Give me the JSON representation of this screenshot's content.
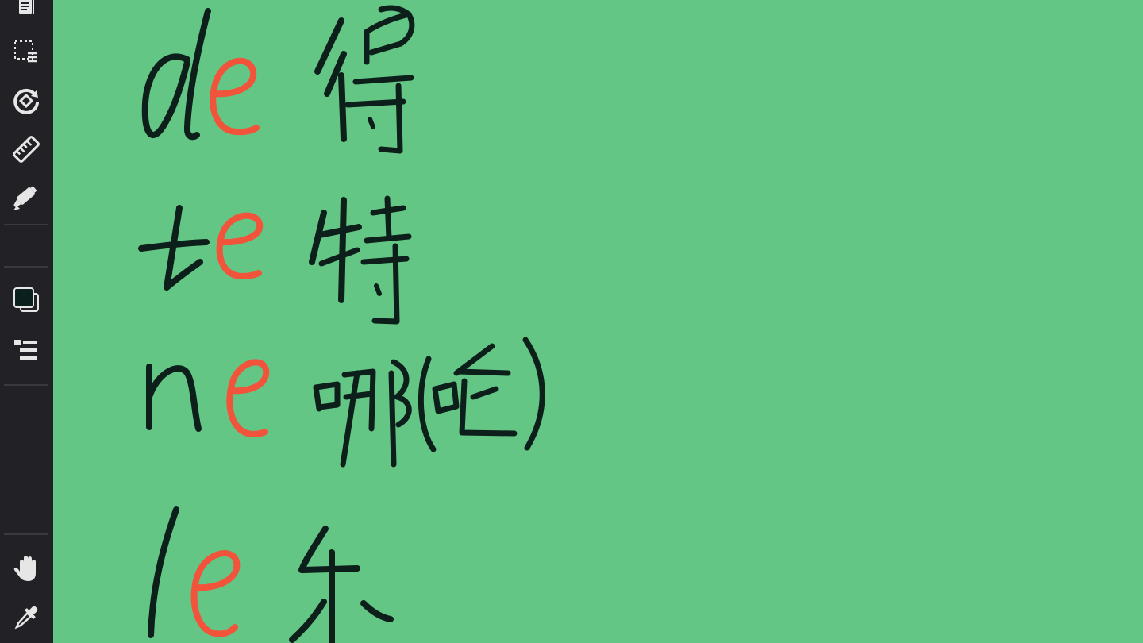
{
  "toolbar": {
    "tools": [
      {
        "name": "document-icon"
      },
      {
        "name": "lasso-select-icon"
      },
      {
        "name": "shape-rotate-icon"
      },
      {
        "name": "ruler-icon"
      },
      {
        "name": "highlighter-icon"
      },
      {
        "name": "color-swatch-icon"
      },
      {
        "name": "layers-list-icon"
      },
      {
        "name": "hand-pan-icon"
      },
      {
        "name": "eyedropper-icon"
      }
    ],
    "colors": {
      "background": "#222126",
      "icon": "#e6e6e6",
      "swatch_front": "#0b1f1c"
    }
  },
  "canvas": {
    "background": "#64c685",
    "ink_dark": "#0d1f1a",
    "ink_red": "#f2533b",
    "rows": [
      {
        "consonant": "d",
        "vowel": "e",
        "character": "得"
      },
      {
        "consonant": "t",
        "vowel": "e",
        "character": "特"
      },
      {
        "consonant": "n",
        "vowel": "e",
        "character": "哪",
        "extra_character": "(呢)"
      },
      {
        "consonant": "l",
        "vowel": "e",
        "character": "乐"
      }
    ]
  }
}
